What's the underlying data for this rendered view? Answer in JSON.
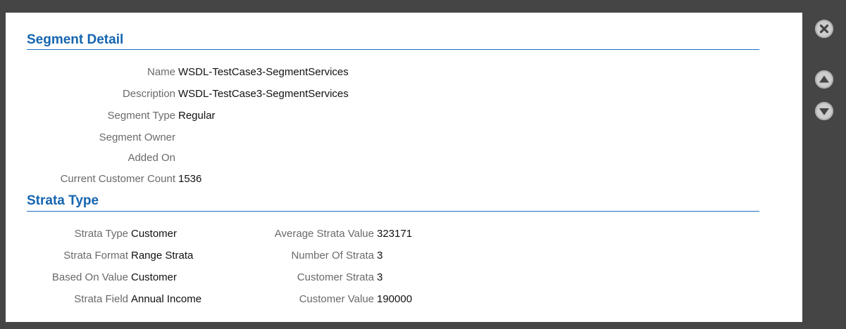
{
  "segment_detail": {
    "title": "Segment Detail",
    "fields": [
      {
        "label": "Name",
        "value": "WSDL-TestCase3-SegmentServices"
      },
      {
        "label": "Description",
        "value": "WSDL-TestCase3-SegmentServices"
      },
      {
        "label": "Segment Type",
        "value": "Regular"
      },
      {
        "label": "Segment Owner",
        "value": ""
      },
      {
        "label": "Added On",
        "value": ""
      },
      {
        "label": "Current Customer Count",
        "value": "1536"
      }
    ]
  },
  "strata_type": {
    "title": "Strata Type",
    "left_fields": [
      {
        "label": "Strata Type",
        "value": "Customer"
      },
      {
        "label": "Strata Format",
        "value": "Range Strata"
      },
      {
        "label": "Based On Value",
        "value": "Customer"
      },
      {
        "label": "Strata Field",
        "value": "Annual Income"
      }
    ],
    "right_fields": [
      {
        "label": "Average Strata Value",
        "value": "323171"
      },
      {
        "label": "Number Of Strata",
        "value": "3"
      },
      {
        "label": "Customer Strata",
        "value": "3"
      },
      {
        "label": "Customer Value",
        "value": "190000"
      }
    ]
  },
  "side_controls": {
    "close_icon": "close-circle-x",
    "up_icon": "up-arrow-circle",
    "down_icon": "down-arrow-circle"
  }
}
